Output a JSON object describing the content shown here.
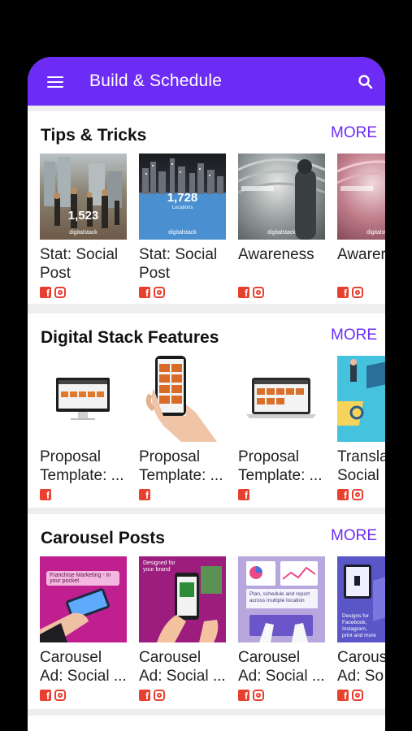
{
  "appbar": {
    "title": "Build & Schedule"
  },
  "sections": [
    {
      "title": "Tips & Tricks",
      "more": "MORE",
      "cards": [
        {
          "title": "Stat: Social\nPost",
          "stat": "1,523",
          "brand": "digitalstack",
          "socials": [
            "facebook",
            "instagram"
          ]
        },
        {
          "title": "Stat: Social\nPost",
          "stat": "1,728",
          "sub": "Locations",
          "brand": "digitalstack",
          "socials": [
            "facebook",
            "instagram"
          ]
        },
        {
          "title": "Awareness",
          "brand": "digitalstack",
          "socials": [
            "facebook",
            "instagram"
          ]
        },
        {
          "title": "Awarer",
          "brand": "digitalstack",
          "socials": [
            "facebook",
            "instagram"
          ]
        }
      ]
    },
    {
      "title": "Digital Stack Features",
      "more": "MORE",
      "cards": [
        {
          "title": "Proposal\nTemplate: ...",
          "socials": [
            "facebook"
          ]
        },
        {
          "title": "Proposal\nTemplate: ...",
          "socials": [
            "facebook"
          ]
        },
        {
          "title": "Proposal\nTemplate: ...",
          "socials": [
            "facebook"
          ]
        },
        {
          "title": "Transla\nSocial",
          "socials": [
            "facebook",
            "instagram"
          ]
        }
      ]
    },
    {
      "title": "Carousel Posts",
      "more": "MORE",
      "cards": [
        {
          "title": "Carousel\nAd: Social ...",
          "caption": "Franchise Marketing - in your pocket",
          "socials": [
            "facebook",
            "instagram"
          ]
        },
        {
          "title": "Carousel\nAd: Social ...",
          "caption": "Designed for your brand",
          "socials": [
            "facebook",
            "instagram"
          ]
        },
        {
          "title": "Carousel\nAd: Social ...",
          "caption": "Plan, schedule and report across multiple location",
          "socials": [
            "facebook",
            "instagram"
          ]
        },
        {
          "title": "Carous\nAd: So",
          "caption": "Designs for Facebook, Instagram, print and more",
          "socials": [
            "facebook",
            "instagram"
          ]
        }
      ]
    }
  ],
  "colors": {
    "accent": "#6d2cf5",
    "social": "#e8402f",
    "background": "#eeeeee"
  }
}
